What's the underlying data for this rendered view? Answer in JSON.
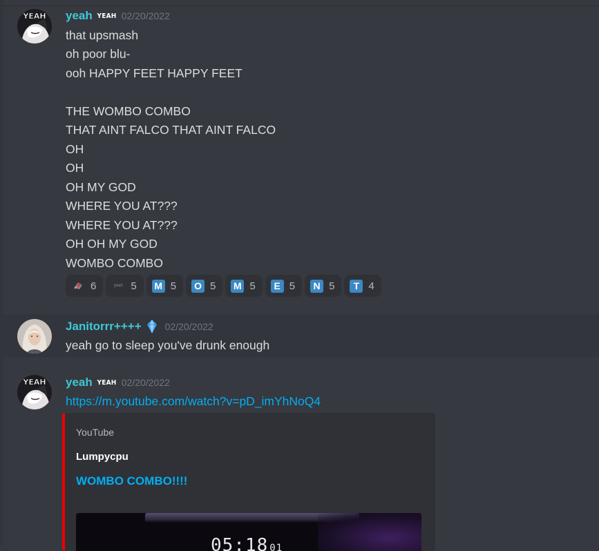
{
  "messages": [
    {
      "username": "yeah",
      "tag": "YEAH",
      "timestamp": "02/20/2022",
      "avatar_icon": "anime-avatar-yeah",
      "lines": [
        "that upsmash",
        "oh poor blu-",
        "ooh HAPPY FEET HAPPY FEET",
        "",
        "THE WOMBO COMBO",
        "THAT AINT FALCO THAT AINT FALCO",
        "OH",
        "OH",
        "OH MY GOD",
        "WHERE YOU AT???",
        "WHERE YOU AT???",
        "OH OH MY GOD",
        "WOMBO COMBO"
      ],
      "reactions": [
        {
          "type": "image",
          "emoji": "custom-emoji-1",
          "count": "6"
        },
        {
          "type": "text",
          "emoji": "yeah",
          "count": "5"
        },
        {
          "type": "letter",
          "emoji": "M",
          "count": "5"
        },
        {
          "type": "letter",
          "emoji": "O",
          "count": "5"
        },
        {
          "type": "letter",
          "emoji": "M",
          "count": "5"
        },
        {
          "type": "letter",
          "emoji": "E",
          "count": "5"
        },
        {
          "type": "letter",
          "emoji": "N",
          "count": "5"
        },
        {
          "type": "letter",
          "emoji": "T",
          "count": "4"
        }
      ]
    },
    {
      "username": "Janitorrr++++",
      "badge": "crystal-icon",
      "timestamp": "02/20/2022",
      "avatar_icon": "portrait-avatar-janitor",
      "lines": [
        "yeah go to sleep you've drunk enough"
      ]
    },
    {
      "username": "yeah",
      "tag": "YEAH",
      "timestamp": "02/20/2022",
      "avatar_icon": "anime-avatar-yeah",
      "link": "https://m.youtube.com/watch?v=pD_imYhNoQ4",
      "embed": {
        "provider": "YouTube",
        "author": "Lumpycpu",
        "title": "WOMBO COMBO!!!!",
        "thumbnail_text": "05:18",
        "thumbnail_text_small": "01",
        "border_color": "#ee0000"
      }
    }
  ],
  "colors": {
    "background": "#36393f",
    "username": "#3fc8d7",
    "link": "#00aff4",
    "text": "#dcddde",
    "timestamp": "#72767d"
  }
}
